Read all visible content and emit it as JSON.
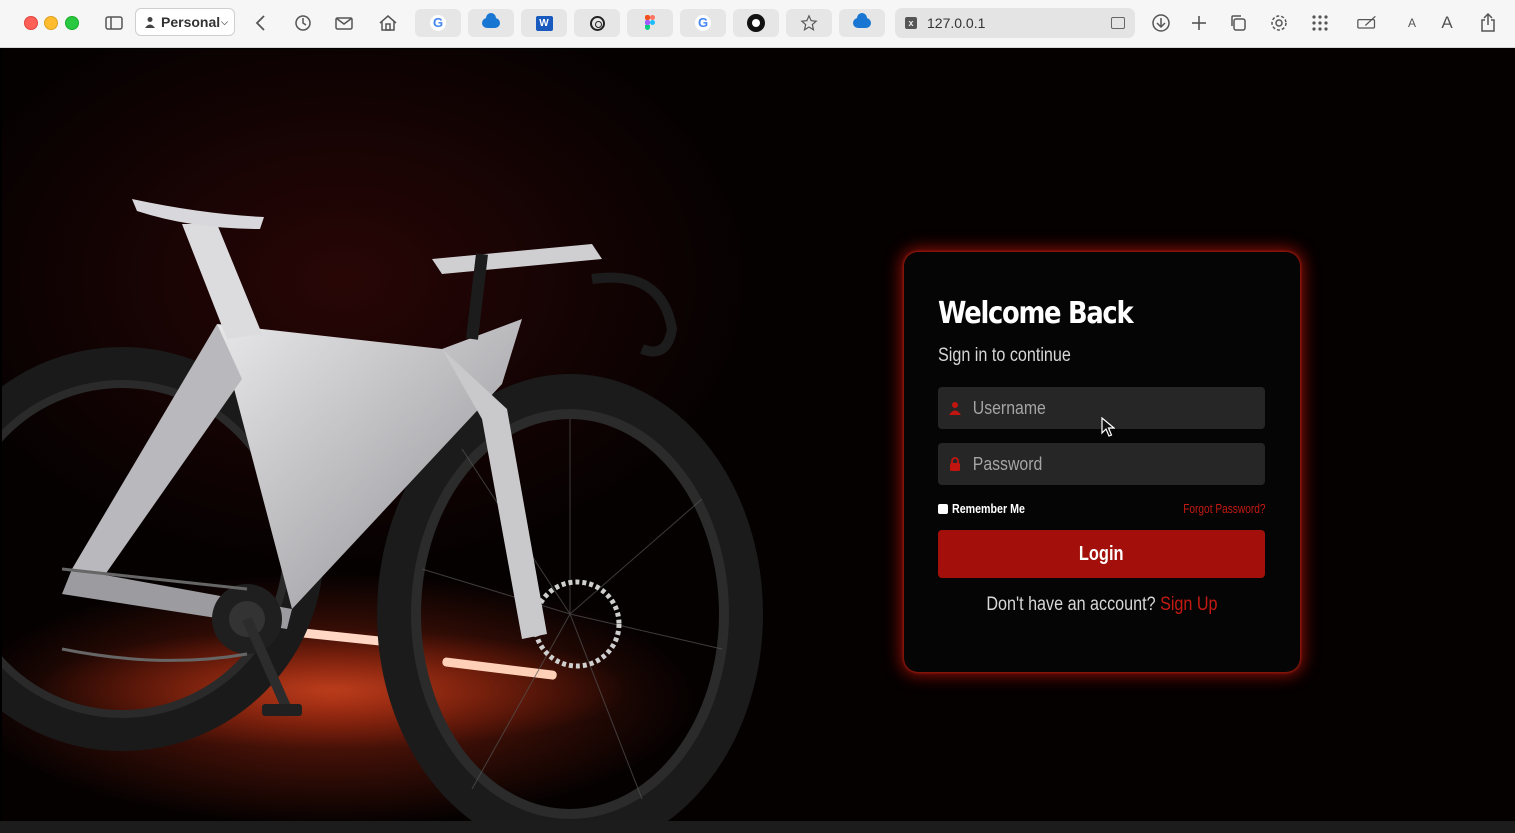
{
  "browser": {
    "profile_label": "Personal",
    "url": "127.0.0.1",
    "favorites": [
      "google-icon",
      "onedrive-icon",
      "word-icon",
      "openai-icon",
      "figma-icon",
      "google-icon",
      "github-icon",
      "star-icon",
      "onedrive-icon"
    ],
    "text_size_small": "A",
    "text_size_large": "A"
  },
  "login": {
    "title": "Welcome Back",
    "subtitle": "Sign in to continue",
    "username_placeholder": "Username",
    "password_placeholder": "Password",
    "remember_label": "Remember Me",
    "forgot_label": "Forgot Password?",
    "login_button": "Login",
    "signup_prompt": "Don't have an account?",
    "signup_link": "Sign Up"
  },
  "colors": {
    "accent": "#a3100b",
    "link": "#c41a12",
    "card_bg": "#050505",
    "field_bg": "#262626"
  }
}
